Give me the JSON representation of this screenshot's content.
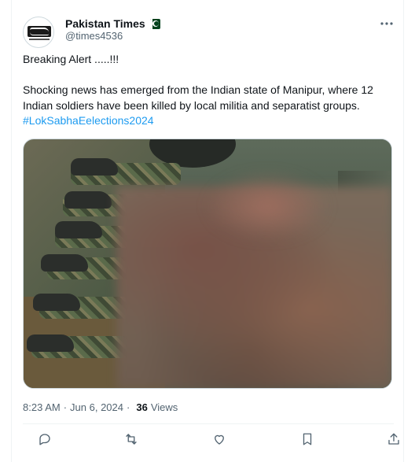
{
  "account": {
    "name": "Pakistan Times",
    "handle": "@times4536"
  },
  "post": {
    "line1": "Breaking Alert .....!!!",
    "line2": " Shocking news has emerged from the Indian state of Manipur, where 12 Indian soldiers have been killed by local militia and separatist groups.",
    "hashtag": "#LokSabhaEelections2024",
    "time": "8:23 AM",
    "date": "Jun 6, 2024",
    "views_count": "36",
    "views_label": "Views"
  },
  "icons": {
    "more": "more-icon",
    "reply": "reply-icon",
    "repost": "repost-icon",
    "like": "like-icon",
    "bookmark": "bookmark-icon",
    "share": "share-icon",
    "flag": "pakistan-flag-icon"
  },
  "colors": {
    "text": "#0f1419",
    "secondary": "#536471",
    "link": "#1d9bf0",
    "border": "#cfd9de"
  }
}
